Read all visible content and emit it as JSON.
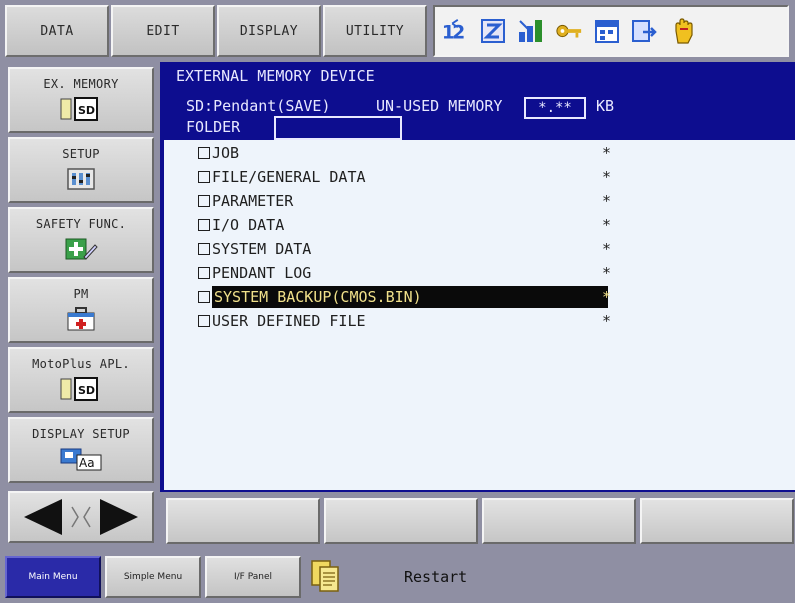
{
  "top_menu": {
    "buttons": [
      "DATA",
      "EDIT",
      "DISPLAY",
      "UTILITY"
    ]
  },
  "status_icons": [
    "numbered-steps-icon",
    "edit-mode-icon",
    "signal-icon",
    "key-icon",
    "calendar-icon",
    "export-icon",
    "hand-icon"
  ],
  "side_menu": {
    "items": [
      {
        "label": "EX. MEMORY",
        "icon": "sd-card-icon"
      },
      {
        "label": "SETUP",
        "icon": "setup-icon"
      },
      {
        "label": "SAFETY FUNC.",
        "icon": "safety-icon"
      },
      {
        "label": "PM",
        "icon": "first-aid-icon"
      },
      {
        "label": "MotoPlus APL.",
        "icon": "sd-card-icon"
      },
      {
        "label": "DISPLAY SETUP",
        "icon": "display-font-icon"
      }
    ]
  },
  "header": {
    "title": "EXTERNAL MEMORY DEVICE",
    "device": "SD:Pendant(SAVE)",
    "unused_label": "UN-USED MEMORY",
    "unused_value": "*.**",
    "unit": "KB",
    "folder_label": "FOLDER",
    "folder_value": ""
  },
  "items": [
    {
      "label": "JOB",
      "mark": "*"
    },
    {
      "label": "FILE/GENERAL DATA",
      "mark": "*"
    },
    {
      "label": "PARAMETER",
      "mark": "*"
    },
    {
      "label": "I/O DATA",
      "mark": "*"
    },
    {
      "label": "SYSTEM DATA",
      "mark": "*"
    },
    {
      "label": "PENDANT LOG",
      "mark": "*"
    },
    {
      "label": "SYSTEM BACKUP(CMOS.BIN)",
      "mark": "*",
      "selected": true
    },
    {
      "label": "USER DEFINED FILE",
      "mark": "*"
    }
  ],
  "bottom_bar": {
    "main_menu": "Main Menu",
    "simple_menu": "Simple Menu",
    "if_panel": "I/F Panel",
    "status_text": "Restart"
  },
  "colors": {
    "main_bg": "#0d0d8f",
    "list_bg": "#eef4fb",
    "selection_bg": "#0a0a0a",
    "selection_fg": "#f0e08a",
    "frame": "#8f8fa3"
  }
}
